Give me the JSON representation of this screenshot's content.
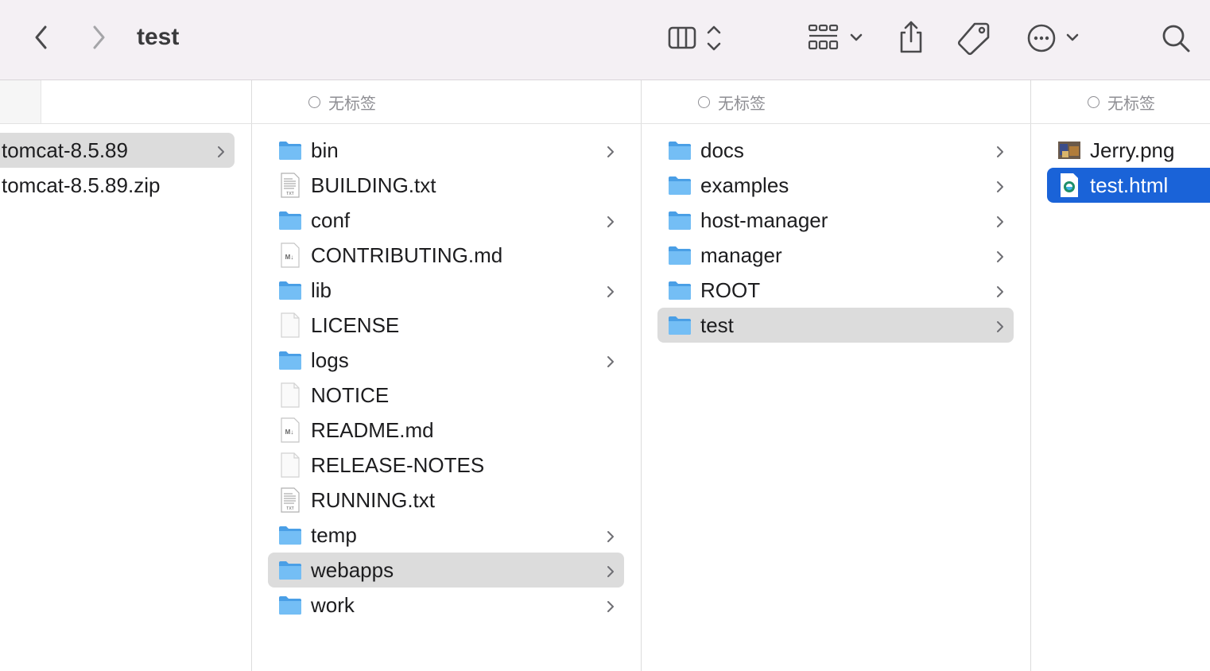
{
  "window": {
    "title": "test"
  },
  "colors": {
    "folder": "#5eb0ef",
    "selection_blue": "#1a63d8",
    "selection_gray": "#dcdcdc",
    "toolbar_bg": "#f4f0f4"
  },
  "columns": [
    {
      "header": "",
      "items": [
        {
          "label": "tomcat-8.5.89",
          "type": "folder-selected-parent",
          "chevron": true
        },
        {
          "label": "tomcat-8.5.89.zip",
          "type": "none",
          "chevron": false
        }
      ]
    },
    {
      "header": "无标签",
      "items": [
        {
          "label": "bin",
          "type": "folder",
          "chevron": true
        },
        {
          "label": "BUILDING.txt",
          "type": "txt",
          "chevron": false
        },
        {
          "label": "conf",
          "type": "folder",
          "chevron": true
        },
        {
          "label": "CONTRIBUTING.md",
          "type": "md",
          "chevron": false
        },
        {
          "label": "lib",
          "type": "folder",
          "chevron": true
        },
        {
          "label": "LICENSE",
          "type": "doc",
          "chevron": false
        },
        {
          "label": "logs",
          "type": "folder",
          "chevron": true
        },
        {
          "label": "NOTICE",
          "type": "doc",
          "chevron": false
        },
        {
          "label": "README.md",
          "type": "md",
          "chevron": false
        },
        {
          "label": "RELEASE-NOTES",
          "type": "doc",
          "chevron": false
        },
        {
          "label": "RUNNING.txt",
          "type": "txt",
          "chevron": false
        },
        {
          "label": "temp",
          "type": "folder",
          "chevron": true
        },
        {
          "label": "webapps",
          "type": "folder",
          "chevron": true
        },
        {
          "label": "work",
          "type": "folder",
          "chevron": true
        }
      ]
    },
    {
      "header": "无标签",
      "items": [
        {
          "label": "docs",
          "type": "folder",
          "chevron": true
        },
        {
          "label": "examples",
          "type": "folder",
          "chevron": true
        },
        {
          "label": "host-manager",
          "type": "folder",
          "chevron": true
        },
        {
          "label": "manager",
          "type": "folder",
          "chevron": true
        },
        {
          "label": "ROOT",
          "type": "folder",
          "chevron": true
        },
        {
          "label": "test",
          "type": "folder",
          "chevron": true
        }
      ]
    },
    {
      "header": "无标签",
      "items": [
        {
          "label": "Jerry.png",
          "type": "image",
          "chevron": false
        },
        {
          "label": "test.html",
          "type": "html",
          "chevron": false
        }
      ]
    }
  ],
  "icons": [
    "back-icon",
    "forward-icon",
    "column-view-icon",
    "grid-group-icon",
    "share-icon",
    "tag-icon",
    "more-icon",
    "search-icon"
  ]
}
